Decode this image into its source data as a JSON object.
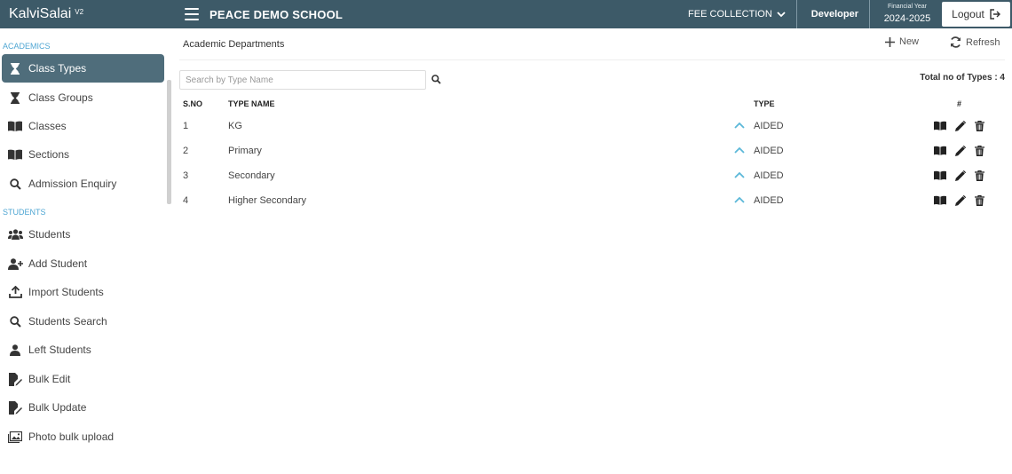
{
  "app": {
    "name": "KalviSalai",
    "version": "V2",
    "school": "PEACE DEMO SCHOOL"
  },
  "header": {
    "fee_menu": "FEE COLLECTION",
    "user": "Developer",
    "fy_label": "Financial Year",
    "fy_value": "2024-2025",
    "logout": "Logout"
  },
  "sidebar": {
    "sections": [
      {
        "title": "ACADEMICS",
        "items": [
          {
            "label": "Class Types",
            "icon": "hourglass-icon",
            "active": true
          },
          {
            "label": "Class Groups",
            "icon": "hourglass-icon"
          },
          {
            "label": "Classes",
            "icon": "book-icon"
          },
          {
            "label": "Sections",
            "icon": "book-icon"
          },
          {
            "label": "Admission Enquiry",
            "icon": "search-icon"
          }
        ]
      },
      {
        "title": "STUDENTS",
        "items": [
          {
            "label": "Students",
            "icon": "users-icon"
          },
          {
            "label": "Add Student",
            "icon": "user-plus-icon"
          },
          {
            "label": "Import Students",
            "icon": "upload-icon"
          },
          {
            "label": "Students Search",
            "icon": "search-icon"
          },
          {
            "label": "Left Students",
            "icon": "user-icon"
          },
          {
            "label": "Bulk Edit",
            "icon": "file-edit-icon"
          },
          {
            "label": "Bulk Update",
            "icon": "file-edit-icon"
          },
          {
            "label": "Photo bulk upload",
            "icon": "image-icon"
          }
        ]
      }
    ]
  },
  "main": {
    "title": "Academic Departments",
    "new_label": "New",
    "refresh_label": "Refresh",
    "search_placeholder": "Search by Type Name",
    "total": "Total no of Types : 4",
    "columns": {
      "sno": "S.NO",
      "name": "TYPE NAME",
      "type": "TYPE",
      "actions": "#"
    },
    "rows": [
      {
        "sno": "1",
        "name": "KG",
        "type": "AIDED"
      },
      {
        "sno": "2",
        "name": "Primary",
        "type": "AIDED"
      },
      {
        "sno": "3",
        "name": "Secondary",
        "type": "AIDED"
      },
      {
        "sno": "4",
        "name": "Higher Secondary",
        "type": "AIDED"
      }
    ]
  },
  "colors": {
    "topbar": "#3d5a68",
    "active": "#4f6d7b",
    "section": "#4fa6d3",
    "chevron": "#5bb8d8"
  }
}
